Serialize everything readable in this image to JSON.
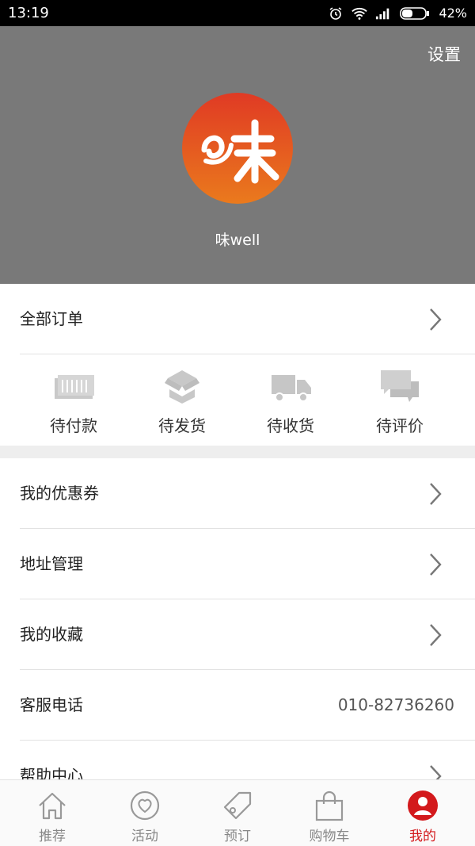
{
  "status_bar": {
    "time": "13:19",
    "battery": "42%"
  },
  "header": {
    "settings_label": "设置",
    "username": "味well",
    "avatar_text": "味"
  },
  "orders": {
    "all_orders_label": "全部订单"
  },
  "order_status": [
    {
      "label": "待付款",
      "icon": "banknote-icon"
    },
    {
      "label": "待发货",
      "icon": "package-icon"
    },
    {
      "label": "待收货",
      "icon": "truck-icon"
    },
    {
      "label": "待评价",
      "icon": "chat-bubbles-icon"
    }
  ],
  "menu": {
    "coupons_label": "我的优惠券",
    "address_label": "地址管理",
    "favorites_label": "我的收藏",
    "service_label": "客服电话",
    "service_phone": "010-82736260",
    "help_label": "帮助中心"
  },
  "tabs": [
    {
      "label": "推荐",
      "icon": "home-icon"
    },
    {
      "label": "活动",
      "icon": "heart-icon"
    },
    {
      "label": "预订",
      "icon": "tag-icon"
    },
    {
      "label": "购物车",
      "icon": "shopping-bag-icon"
    },
    {
      "label": "我的",
      "icon": "user-icon",
      "active": true
    }
  ],
  "colors": {
    "header_bg": "#797979",
    "accent_red": "#d3191c",
    "avatar_top": "#e03a24",
    "avatar_bottom": "#ea7a1d"
  }
}
